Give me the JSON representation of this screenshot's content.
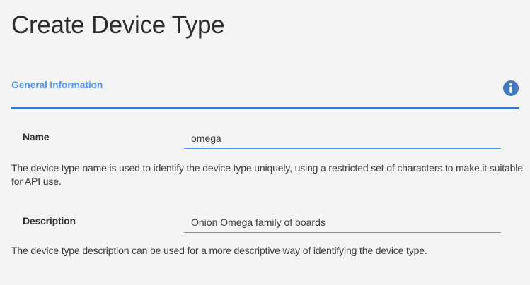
{
  "page": {
    "title": "Create Device Type"
  },
  "section": {
    "title": "General Information",
    "info_icon": "info-circle-icon",
    "accent_color": "#4178be"
  },
  "fields": {
    "name": {
      "label": "Name",
      "value": "omega",
      "help": "The device type name is used to identify the device type uniquely, using a restricted set of characters to make it suitable for API use."
    },
    "description": {
      "label": "Description",
      "value": "Onion Omega family of boards",
      "help": "The device type description can be used for a more descriptive way of identifying the device type."
    }
  }
}
